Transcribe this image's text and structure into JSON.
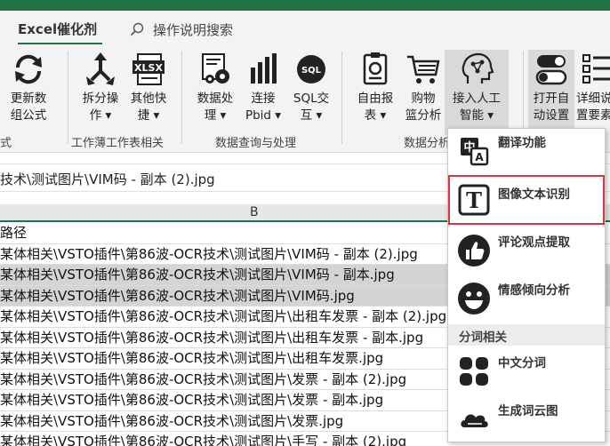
{
  "tabs": {
    "active": "Excel催化剂",
    "search_label": "操作说明搜索"
  },
  "ribbon": {
    "buttons": [
      {
        "line1": "更新数",
        "line2": "组公式"
      },
      {
        "line1": "拆分操",
        "line2": "作 ▾"
      },
      {
        "line1": "其他快",
        "line2": "捷 ▾"
      },
      {
        "line1": "数据处",
        "line2": "理 ▾"
      },
      {
        "line1": "连接",
        "line2": "Pbid ▾"
      },
      {
        "line1": "SQL交",
        "line2": "互 ▾"
      },
      {
        "line1": "自由报",
        "line2": "表 ▾"
      },
      {
        "line1": "购物",
        "line2": "篮分析"
      },
      {
        "line1": "接入人工",
        "line2": "智能 ▾"
      },
      {
        "line1": "打开自",
        "line2": "动设置"
      },
      {
        "line1": "详细说",
        "line2": "置要素"
      }
    ],
    "groups": [
      "式",
      "工作薄工作表相关",
      "数据查询与处理",
      "数据分析"
    ],
    "xlsx_icon_text": "XLSX",
    "sql_icon_text": "SQL"
  },
  "formula_bar": {
    "text": "技术\\测试图片\\VIM码 - 副本 (2).jpg"
  },
  "column_header": "B",
  "rows": [
    {
      "text": "路径",
      "selected": false
    },
    {
      "text": "某体相关\\VSTO插件\\第86波-OCR技术\\测试图片\\VIM码 - 副本 (2).jpg",
      "selected": false
    },
    {
      "text": "某体相关\\VSTO插件\\第86波-OCR技术\\测试图片\\VIM码 - 副本.jpg",
      "selected": true
    },
    {
      "text": "某体相关\\VSTO插件\\第86波-OCR技术\\测试图片\\VIM码.jpg",
      "selected": true
    },
    {
      "text": "某体相关\\VSTO插件\\第86波-OCR技术\\测试图片\\出租车发票 - 副本 (2).jpg",
      "selected": false
    },
    {
      "text": "某体相关\\VSTO插件\\第86波-OCR技术\\测试图片\\出租车发票 - 副本.jpg",
      "selected": false
    },
    {
      "text": "某体相关\\VSTO插件\\第86波-OCR技术\\测试图片\\出租车发票.jpg",
      "selected": false
    },
    {
      "text": "某体相关\\VSTO插件\\第86波-OCR技术\\测试图片\\发票 - 副本 (2).jpg",
      "selected": false
    },
    {
      "text": "某体相关\\VSTO插件\\第86波-OCR技术\\测试图片\\发票 - 副本.jpg",
      "selected": false
    },
    {
      "text": "某体相关\\VSTO插件\\第86波-OCR技术\\测试图片\\发票.jpg",
      "selected": false
    },
    {
      "text": "某体相关\\VSTO插件\\第86波-OCR技术\\测试图片\\手写 - 副本 (2).jpg",
      "selected": false
    }
  ],
  "menu": {
    "items": [
      {
        "label": "翻译功能",
        "icon": "translate-icon"
      },
      {
        "label": "图像文本识别",
        "icon": "text-recognition-icon",
        "highlighted": true
      },
      {
        "label": "评论观点提取",
        "icon": "thumbs-up-icon"
      },
      {
        "label": "情感倾向分析",
        "icon": "smiley-icon"
      },
      {
        "label": "中文分词",
        "icon": "grid-icon"
      },
      {
        "label": "生成词云图",
        "icon": "cloud-icon"
      }
    ],
    "section_label": "分词相关",
    "translate_icon_chars": [
      "中",
      "A"
    ],
    "ocr_icon_char": "T"
  },
  "colors": {
    "accent": "#217346",
    "highlight": "#d9363e"
  }
}
